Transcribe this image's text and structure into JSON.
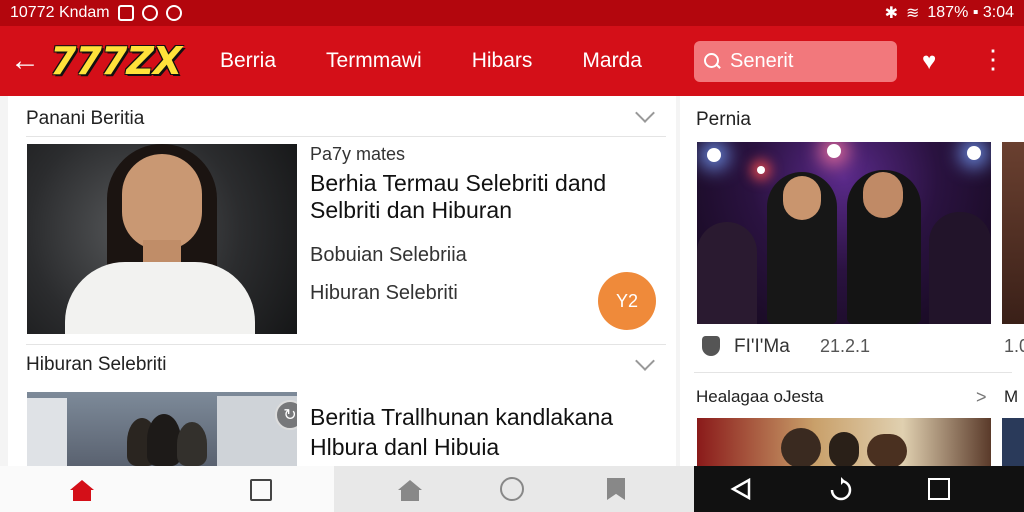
{
  "status_bar": {
    "left_text": "10772 Kndam",
    "right_text": "187% ▪ 3:04"
  },
  "header": {
    "logo": "777ZX",
    "nav": [
      "Berria",
      "Termmawi",
      "Hibars",
      "Marda"
    ],
    "search_placeholder": "Senerit"
  },
  "main": {
    "section1_title": "Panani Beritia",
    "article1": {
      "kicker": "Pa7y mates",
      "headline": "Berhia Termau Selebriti dand Selbriti dan Hiburan",
      "sub1": "Bobuian Selebriia",
      "sub2": "Hiburan Selebriti",
      "badge": "Y2"
    },
    "section2_title": "Hiburan Selebriti",
    "article2": {
      "headline": "Beritia Trallhunan kandlakana Hlbura danl Hibuia"
    }
  },
  "sidebar": {
    "title": "Pernia",
    "meta_source": "FI'I'Ma",
    "meta_time": "21.2.1",
    "meta_time2": "1.0",
    "section2_title": "Healagaa oJesta",
    "section2_arrow": ">",
    "section2_next": "M"
  }
}
